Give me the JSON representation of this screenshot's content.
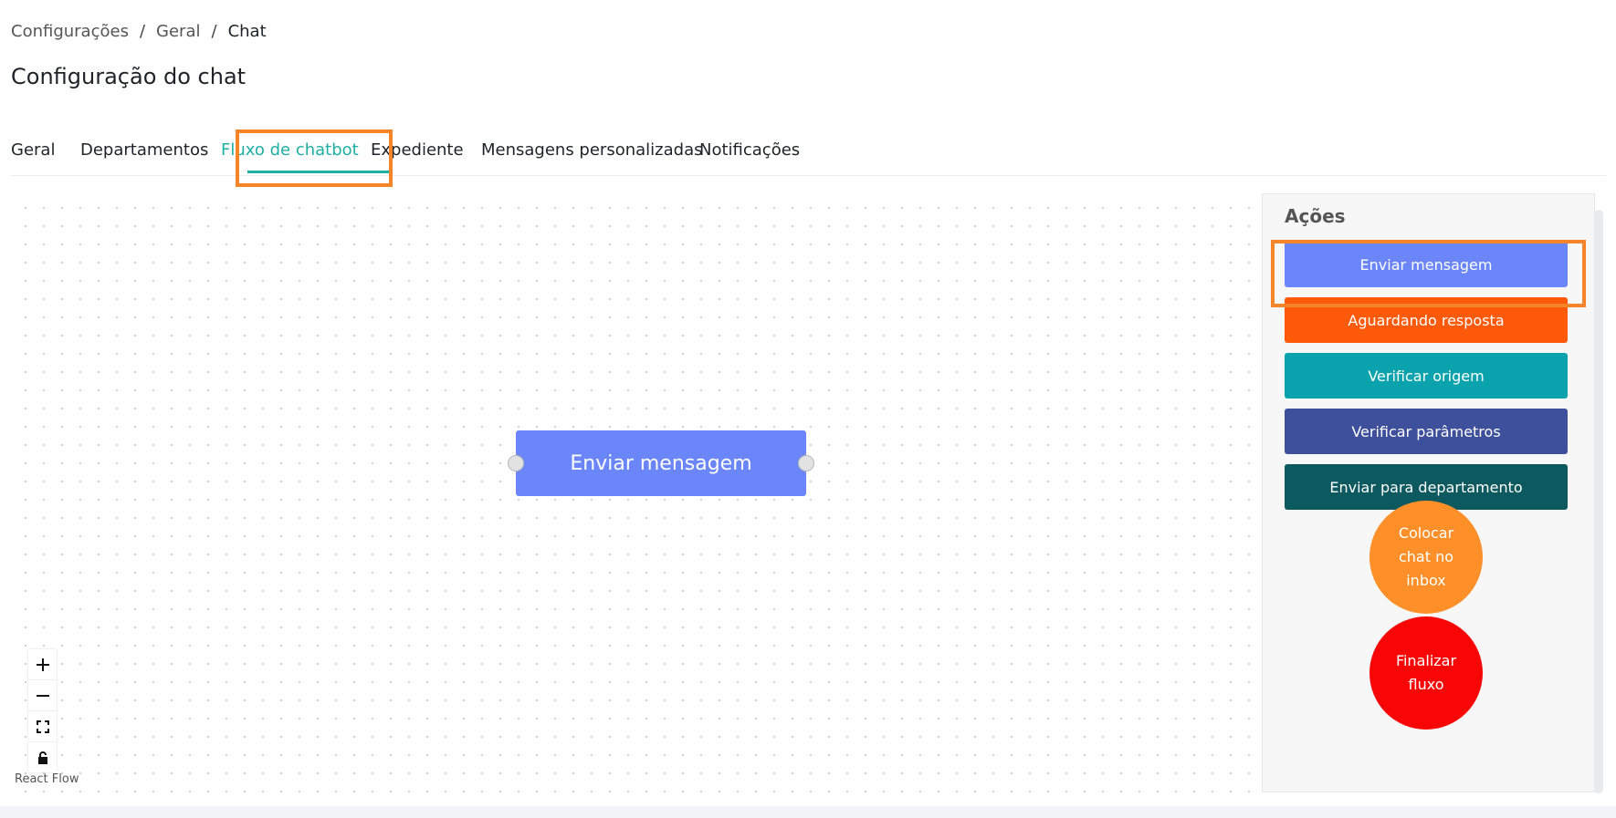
{
  "breadcrumb": {
    "items": [
      "Configurações",
      "Geral",
      "Chat"
    ],
    "separator": "/"
  },
  "page": {
    "title": "Configuração do chat"
  },
  "tabs": [
    {
      "label": "Geral"
    },
    {
      "label": "Departamentos"
    },
    {
      "label": "Fluxo de chatbot",
      "active": true
    },
    {
      "label": "Expediente"
    },
    {
      "label": "Mensagens personalizadas"
    },
    {
      "label": "Notificações"
    }
  ],
  "flow": {
    "node_label": "Enviar mensagem",
    "node_color": "#6a86fa",
    "attribution": "React Flow",
    "controls": [
      {
        "name": "zoom-in",
        "glyph": "+"
      },
      {
        "name": "zoom-out",
        "glyph": "−"
      },
      {
        "name": "fit-view",
        "glyph": "⛶"
      },
      {
        "name": "lock",
        "glyph": "🔒"
      }
    ]
  },
  "actions": {
    "title": "Ações",
    "buttons": [
      {
        "label": "Enviar mensagem",
        "color": "#6a86fa"
      },
      {
        "label": "Aguardando resposta",
        "color": "#ff5a0a"
      },
      {
        "label": "Verificar origem",
        "color": "#0aa3ad"
      },
      {
        "label": "Verificar parâmetros",
        "color": "#3e4f9c"
      },
      {
        "label": "Enviar para departamento",
        "color": "#0d5960"
      }
    ],
    "circles": [
      {
        "label": "Colocar chat no inbox",
        "color": "#ff8f28"
      },
      {
        "label": "Finalizar fluxo",
        "color": "#f80606"
      }
    ]
  },
  "colors": {
    "accent": "#1fb0a4",
    "highlight": "#f68428"
  }
}
